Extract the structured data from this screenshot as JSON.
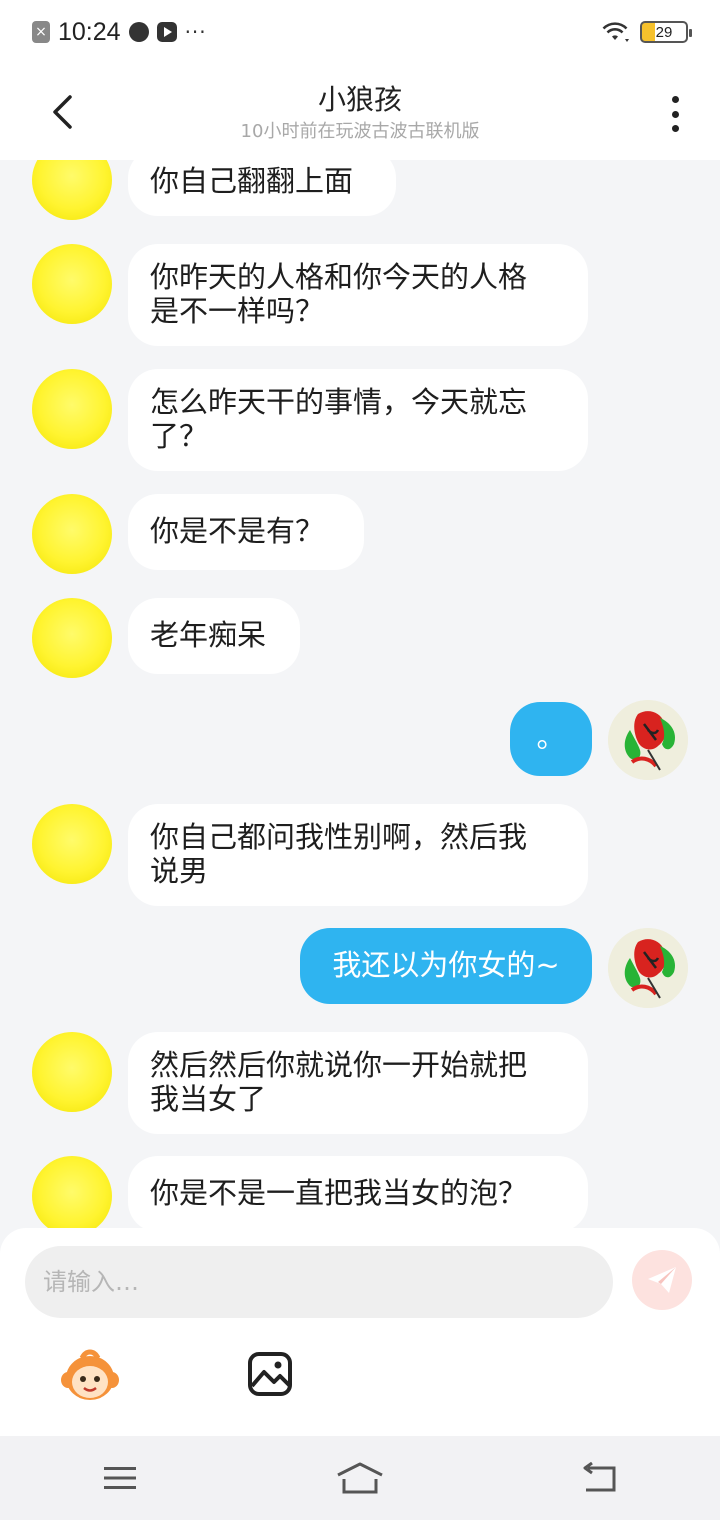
{
  "status_bar": {
    "time": "10:24",
    "dots": "···",
    "battery": "29",
    "icons": [
      "close-box-icon",
      "browser-icon",
      "play-icon",
      "wifi-icon",
      "battery-icon"
    ]
  },
  "header": {
    "title": "小狼孩",
    "subtitle": "10小时前在玩波古波古联机版",
    "back_icon": "chevron-left-icon",
    "more_icon": "more-vertical-icon"
  },
  "messages": [
    {
      "from": "other",
      "text": "你自己翻翻上面"
    },
    {
      "from": "other",
      "text": "你昨天的人格和你今天的人格\n是不一样吗？"
    },
    {
      "from": "other",
      "text": "怎么昨天干的事情，今天就忘\n了？"
    },
    {
      "from": "other",
      "text": "你是不是有？"
    },
    {
      "from": "other",
      "text": "老年痴呆"
    },
    {
      "from": "self",
      "text": "。"
    },
    {
      "from": "other",
      "text": "你自己都问我性别啊，然后我\n说男"
    },
    {
      "from": "self",
      "text": "我还以为你女的~"
    },
    {
      "from": "other",
      "text": "然后然后你就说你一开始就把\n我当女了"
    },
    {
      "from": "other",
      "text": "你是不是一直把我当女的泡？"
    }
  ],
  "input": {
    "placeholder": "请输入…",
    "value": ""
  },
  "toolbar": {
    "send_icon": "paper-plane-icon",
    "emoji_icon": "monkey-emoji-icon",
    "image_icon": "image-icon"
  },
  "nav": {
    "icons": [
      "menu-icon",
      "home-icon",
      "back-icon"
    ]
  },
  "colors": {
    "self_bubble": "#2fb4f0",
    "other_bubble": "#ffffff",
    "chat_background": "#f4f5f7",
    "send_button": "#fde2df"
  }
}
